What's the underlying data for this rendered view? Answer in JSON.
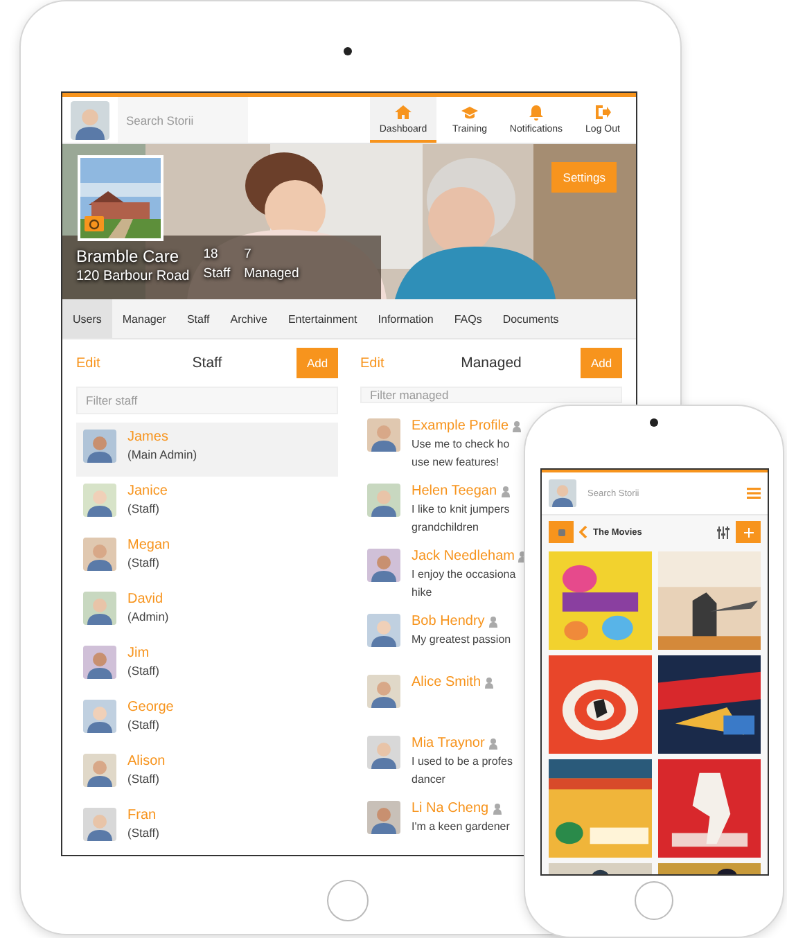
{
  "ipad": {
    "header": {
      "search_placeholder": "Search Storii",
      "nav": [
        {
          "label": "Dashboard",
          "selected": true
        },
        {
          "label": "Training",
          "selected": false
        },
        {
          "label": "Notifications",
          "selected": false
        },
        {
          "label": "Log Out",
          "selected": false
        }
      ]
    },
    "hero": {
      "settings": "Settings",
      "name": "Bramble Care",
      "address": "120 Barbour Road",
      "stats": [
        {
          "value": "18",
          "label": "Staff"
        },
        {
          "value": "7",
          "label": "Managed"
        }
      ]
    },
    "tabs": [
      {
        "label": "Users",
        "selected": true
      },
      {
        "label": "Manager",
        "selected": false
      },
      {
        "label": "Staff",
        "selected": false
      },
      {
        "label": "Archive",
        "selected": false
      },
      {
        "label": "Entertainment",
        "selected": false
      },
      {
        "label": "Information",
        "selected": false
      },
      {
        "label": "FAQs",
        "selected": false
      },
      {
        "label": "Documents",
        "selected": false
      }
    ],
    "staff": {
      "edit": "Edit",
      "title": "Staff",
      "add": "Add",
      "filter_placeholder": "Filter staff",
      "items": [
        {
          "name": "James",
          "role": "(Main Admin)",
          "selected": true
        },
        {
          "name": "Janice",
          "role": "(Staff)",
          "selected": false
        },
        {
          "name": "Megan",
          "role": "(Staff)",
          "selected": false
        },
        {
          "name": "David",
          "role": "(Admin)",
          "selected": false
        },
        {
          "name": "Jim",
          "role": "(Staff)",
          "selected": false
        },
        {
          "name": "George",
          "role": "(Staff)",
          "selected": false
        },
        {
          "name": "Alison",
          "role": "(Staff)",
          "selected": false
        },
        {
          "name": "Fran",
          "role": "(Staff)",
          "selected": false
        }
      ]
    },
    "managed": {
      "edit": "Edit",
      "title": "Managed",
      "add": "Add",
      "filter_placeholder": "Filter managed",
      "items": [
        {
          "name": "Example Profile",
          "bio": [
            "Use me to check ho",
            "use new features!"
          ]
        },
        {
          "name": "Helen Teegan",
          "bio": [
            "I like to knit jumpers",
            "grandchildren"
          ]
        },
        {
          "name": "Jack Needleham",
          "bio": [
            "I enjoy the occasiona",
            "hike"
          ]
        },
        {
          "name": "Bob Hendry",
          "bio": [
            "My greatest passion"
          ]
        },
        {
          "name": "Alice Smith"
        },
        {
          "name": "Mia Traynor",
          "bio": [
            "I used to be a profes",
            "dancer"
          ]
        },
        {
          "name": "Li Na Cheng",
          "bio": [
            "I'm a keen gardener"
          ]
        }
      ]
    }
  },
  "phone": {
    "search_placeholder": "Search Storii",
    "title": "The Movies"
  }
}
